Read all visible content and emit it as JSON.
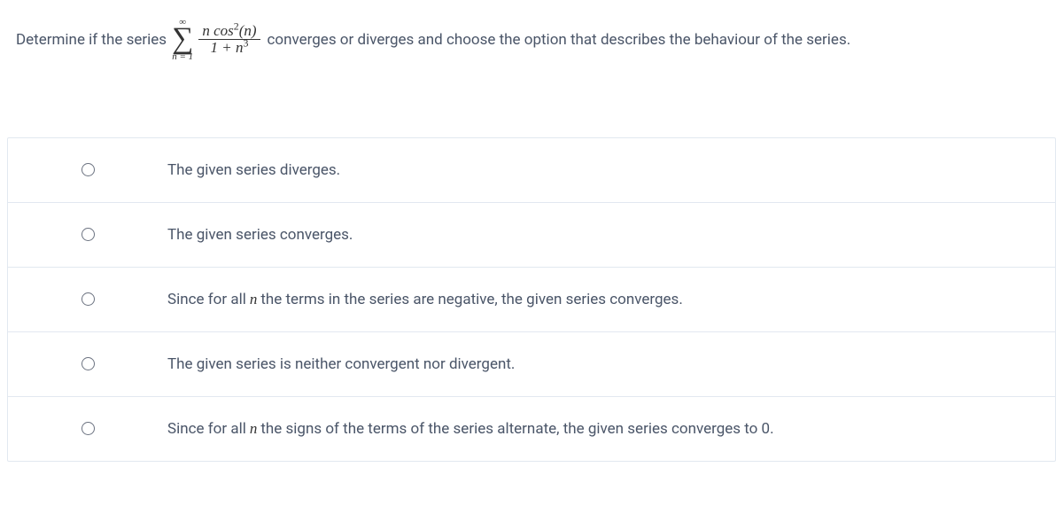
{
  "question": {
    "lead": "Determine if the series",
    "sum_top": "∞",
    "sum_bottom": "n = 1",
    "frac_num": "n cos²(n)",
    "frac_den": "1 + n³",
    "tail": "converges or diverges and choose the option that describes the behaviour of the series."
  },
  "options": [
    {
      "parts": [
        "The given series diverges."
      ]
    },
    {
      "parts": [
        "The given series converges."
      ]
    },
    {
      "parts": [
        "Since for all",
        "MATH_N",
        "the terms in the series are negative, the given series converges."
      ]
    },
    {
      "parts": [
        "The given series is neither convergent nor divergent."
      ]
    },
    {
      "parts": [
        "Since for all",
        "MATH_N",
        "the signs of the terms of the series alternate, the given series converges to 0."
      ]
    }
  ],
  "math_n": "n"
}
